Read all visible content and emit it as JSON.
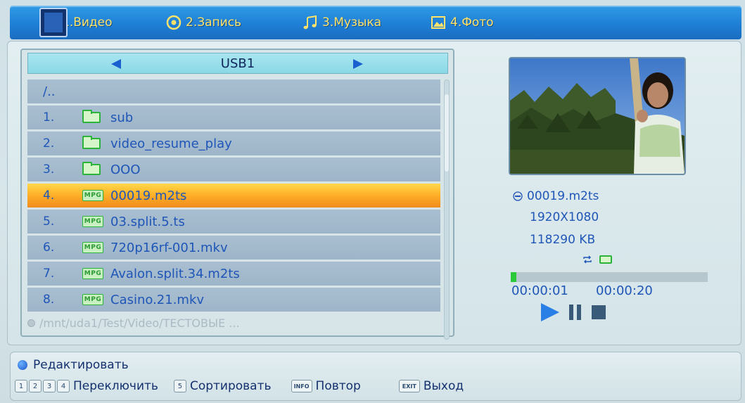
{
  "tabs": [
    {
      "label": "1.Видео",
      "icon": "film-icon",
      "active": true
    },
    {
      "label": "2.Запись",
      "icon": "record-icon",
      "active": false
    },
    {
      "label": "3.Музыка",
      "icon": "music-note-icon",
      "active": false
    },
    {
      "label": "4.Фото",
      "icon": "photo-icon",
      "active": false
    }
  ],
  "browser": {
    "device": "USB1",
    "parent": "/..",
    "files": [
      {
        "num": "1.",
        "name": "sub",
        "type": "folder"
      },
      {
        "num": "2.",
        "name": "video_resume_play",
        "type": "folder"
      },
      {
        "num": "3.",
        "name": "OOO",
        "type": "folder"
      },
      {
        "num": "4.",
        "name": "00019.m2ts",
        "type": "mpg",
        "selected": true
      },
      {
        "num": "5.",
        "name": "03.split.5.ts",
        "type": "mpg"
      },
      {
        "num": "6.",
        "name": "720p16rf-001.mkv",
        "type": "mpg"
      },
      {
        "num": "7.",
        "name": "Avalon.split.34.m2ts",
        "type": "mpg"
      },
      {
        "num": "8.",
        "name": "Casino.21.mkv",
        "type": "mpg"
      }
    ],
    "mpg_badge": "MPG",
    "path": "/mnt/uda1/Test/Video/ТЕСТОВЫЕ ..."
  },
  "preview": {
    "filename": "00019.m2ts",
    "resolution": "1920X1080",
    "size": "118290 KB",
    "progress_fraction": 0.03,
    "time_current": "00:00:01",
    "time_total": "00:00:20"
  },
  "help": {
    "edit": "Редактировать",
    "keys": {
      "k1": "1",
      "k2": "2",
      "k3": "3",
      "k4": "4",
      "switch": "Переключить",
      "k5": "5",
      "sort": "Сортировать",
      "info_key": "INFO",
      "repeat": "Повтор",
      "exit_key": "EXIT",
      "exit": "Выход"
    }
  },
  "colors": {
    "accent_blue": "#1f56b8",
    "tab_text": "#ffe36a",
    "selection": "#ffb22a",
    "progress": "#29c93a"
  }
}
